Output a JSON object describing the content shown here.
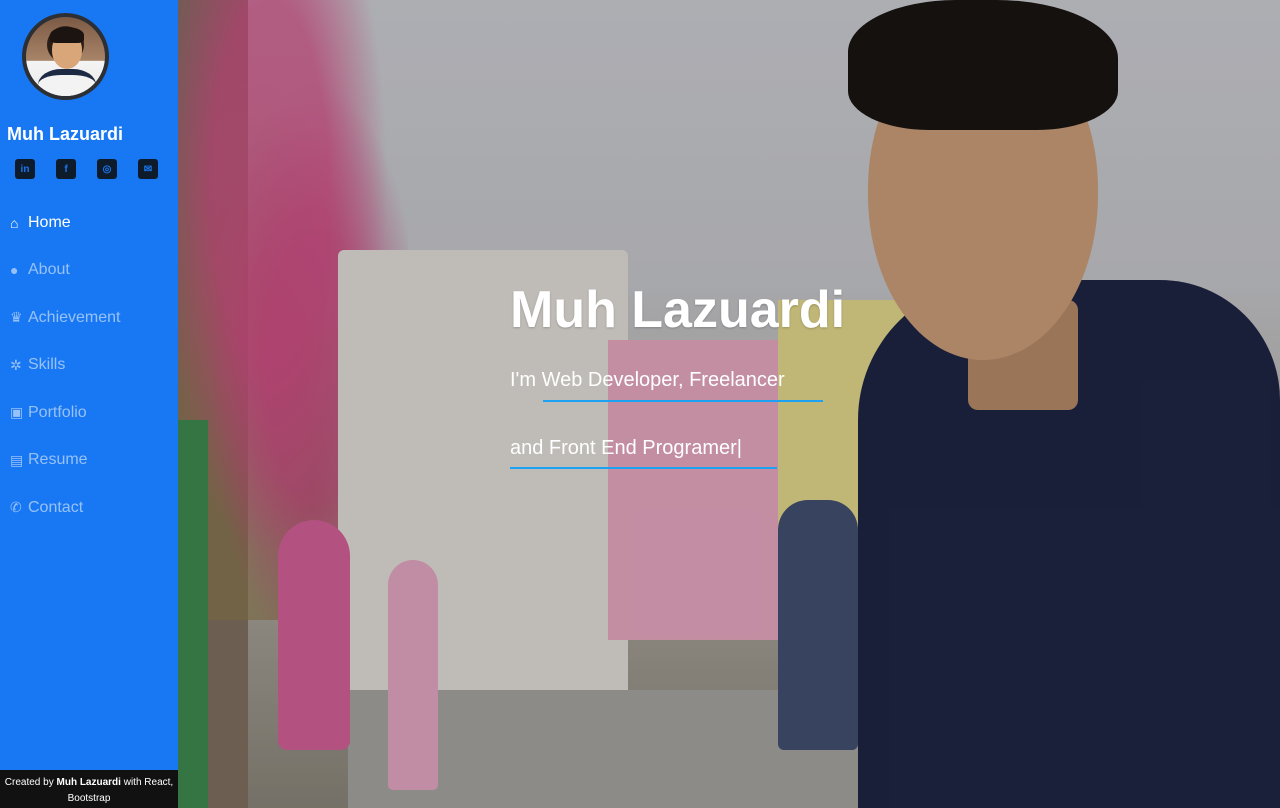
{
  "profile": {
    "name": "Muh Lazuardi"
  },
  "socials": [
    {
      "icon": "linkedin-icon",
      "glyph": "in"
    },
    {
      "icon": "facebook-icon",
      "glyph": "f"
    },
    {
      "icon": "instagram-icon",
      "glyph": "◎"
    },
    {
      "icon": "mail-icon",
      "glyph": "✉"
    }
  ],
  "nav": [
    {
      "label": "Home",
      "icon": "home-icon",
      "glyph": "⌂",
      "active": true
    },
    {
      "label": "About",
      "icon": "user-icon",
      "glyph": "●",
      "active": false
    },
    {
      "label": "Achievement",
      "icon": "trophy-icon",
      "glyph": "♛",
      "active": false
    },
    {
      "label": "Skills",
      "icon": "skills-icon",
      "glyph": "✲",
      "active": false
    },
    {
      "label": "Portfolio",
      "icon": "image-icon",
      "glyph": "▣",
      "active": false
    },
    {
      "label": "Resume",
      "icon": "file-icon",
      "glyph": "▤",
      "active": false
    },
    {
      "label": "Contact",
      "icon": "phone-icon",
      "glyph": "✆",
      "active": false
    }
  ],
  "footer": {
    "prefix": "Created by ",
    "author": "Muh Lazuardi",
    "suffix": " with React,",
    "line2": "Bootstrap"
  },
  "hero": {
    "title": "Muh Lazuardi",
    "line1": "I'm Web Developer, Freelancer",
    "line2": "and Front End Programer|"
  },
  "colors": {
    "sidebar": "#1877f2",
    "accent_underline": "#1da1f2",
    "footer": "#111111"
  }
}
